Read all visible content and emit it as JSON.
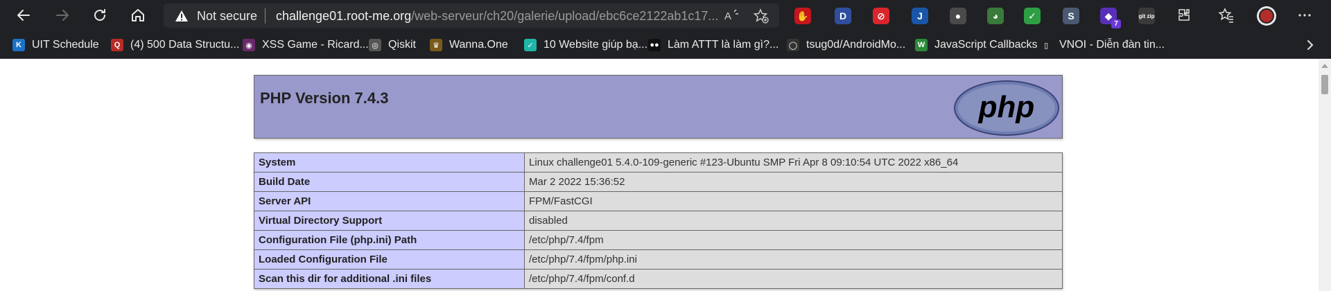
{
  "browser": {
    "security_label": "Not secure",
    "url_host": "challenge01.root-me.org",
    "url_path": "/web-serveur/ch20/galerie/upload/ebc6ce2122ab1c17...",
    "extensions": [
      {
        "name": "ublock-extension-icon",
        "glyph": "✋",
        "color": "#c4161c"
      },
      {
        "name": "dashlane-extension-icon",
        "glyph": "D",
        "color": "#2f4f9e"
      },
      {
        "name": "block-extension-icon",
        "glyph": "⊘",
        "color": "#d9262c"
      },
      {
        "name": "j-extension-icon",
        "glyph": "J",
        "color": "#1a56a8"
      },
      {
        "name": "gray-extension-icon",
        "glyph": "●",
        "color": "#4a4a4a"
      },
      {
        "name": "colorful-extension-icon",
        "glyph": "◕",
        "color": "#3a7a3a"
      },
      {
        "name": "shield-extension-icon",
        "glyph": "✓",
        "color": "#2e9e44"
      },
      {
        "name": "s-extension-icon",
        "glyph": "S",
        "color": "#4a5a72"
      },
      {
        "name": "purple-extension-icon",
        "glyph": "◆",
        "color": "#5a2fb8",
        "badge": "7"
      },
      {
        "name": "gitzip-extension-icon",
        "glyph": "git zip",
        "color": "#3a3a3a"
      }
    ]
  },
  "bookmarks": [
    {
      "label": "UIT Schedule",
      "icon": "K",
      "color": "#1a73c8"
    },
    {
      "label": "(4) 500 Data Structu...",
      "icon": "Q",
      "color": "#b92b27"
    },
    {
      "label": "XSS Game - Ricard...",
      "icon": "◉",
      "color": "#6a2a6a"
    },
    {
      "label": "Qiskit",
      "icon": "◎",
      "color": "#555555"
    },
    {
      "label": "Wanna.One",
      "icon": "♛",
      "color": "#7a5a1a"
    },
    {
      "label": "10 Website giúp bạ...",
      "icon": "✓",
      "color": "#1fb5a8"
    },
    {
      "label": "Làm ATTT là làm gì?...",
      "icon": "●●",
      "color": "#111111"
    },
    {
      "label": "tsug0d/AndroidMo...",
      "icon": "◯",
      "color": "#333333"
    },
    {
      "label": "JavaScript Callbacks",
      "icon": "W",
      "color": "#2a8a3a"
    },
    {
      "label": "VNOI - Diễn đàn tin...",
      "icon": "▯",
      "color": "#202124"
    }
  ],
  "phpinfo": {
    "title": "PHP Version 7.4.3",
    "logo_text": "php",
    "rows": [
      {
        "key": "System",
        "value": "Linux challenge01 5.4.0-109-generic #123-Ubuntu SMP Fri Apr 8 09:10:54 UTC 2022 x86_64"
      },
      {
        "key": "Build Date",
        "value": "Mar 2 2022 15:36:52"
      },
      {
        "key": "Server API",
        "value": "FPM/FastCGI"
      },
      {
        "key": "Virtual Directory Support",
        "value": "disabled"
      },
      {
        "key": "Configuration File (php.ini) Path",
        "value": "/etc/php/7.4/fpm"
      },
      {
        "key": "Loaded Configuration File",
        "value": "/etc/php/7.4/fpm/php.ini"
      },
      {
        "key": "Scan this dir for additional .ini files",
        "value": "/etc/php/7.4/fpm/conf.d"
      }
    ]
  }
}
